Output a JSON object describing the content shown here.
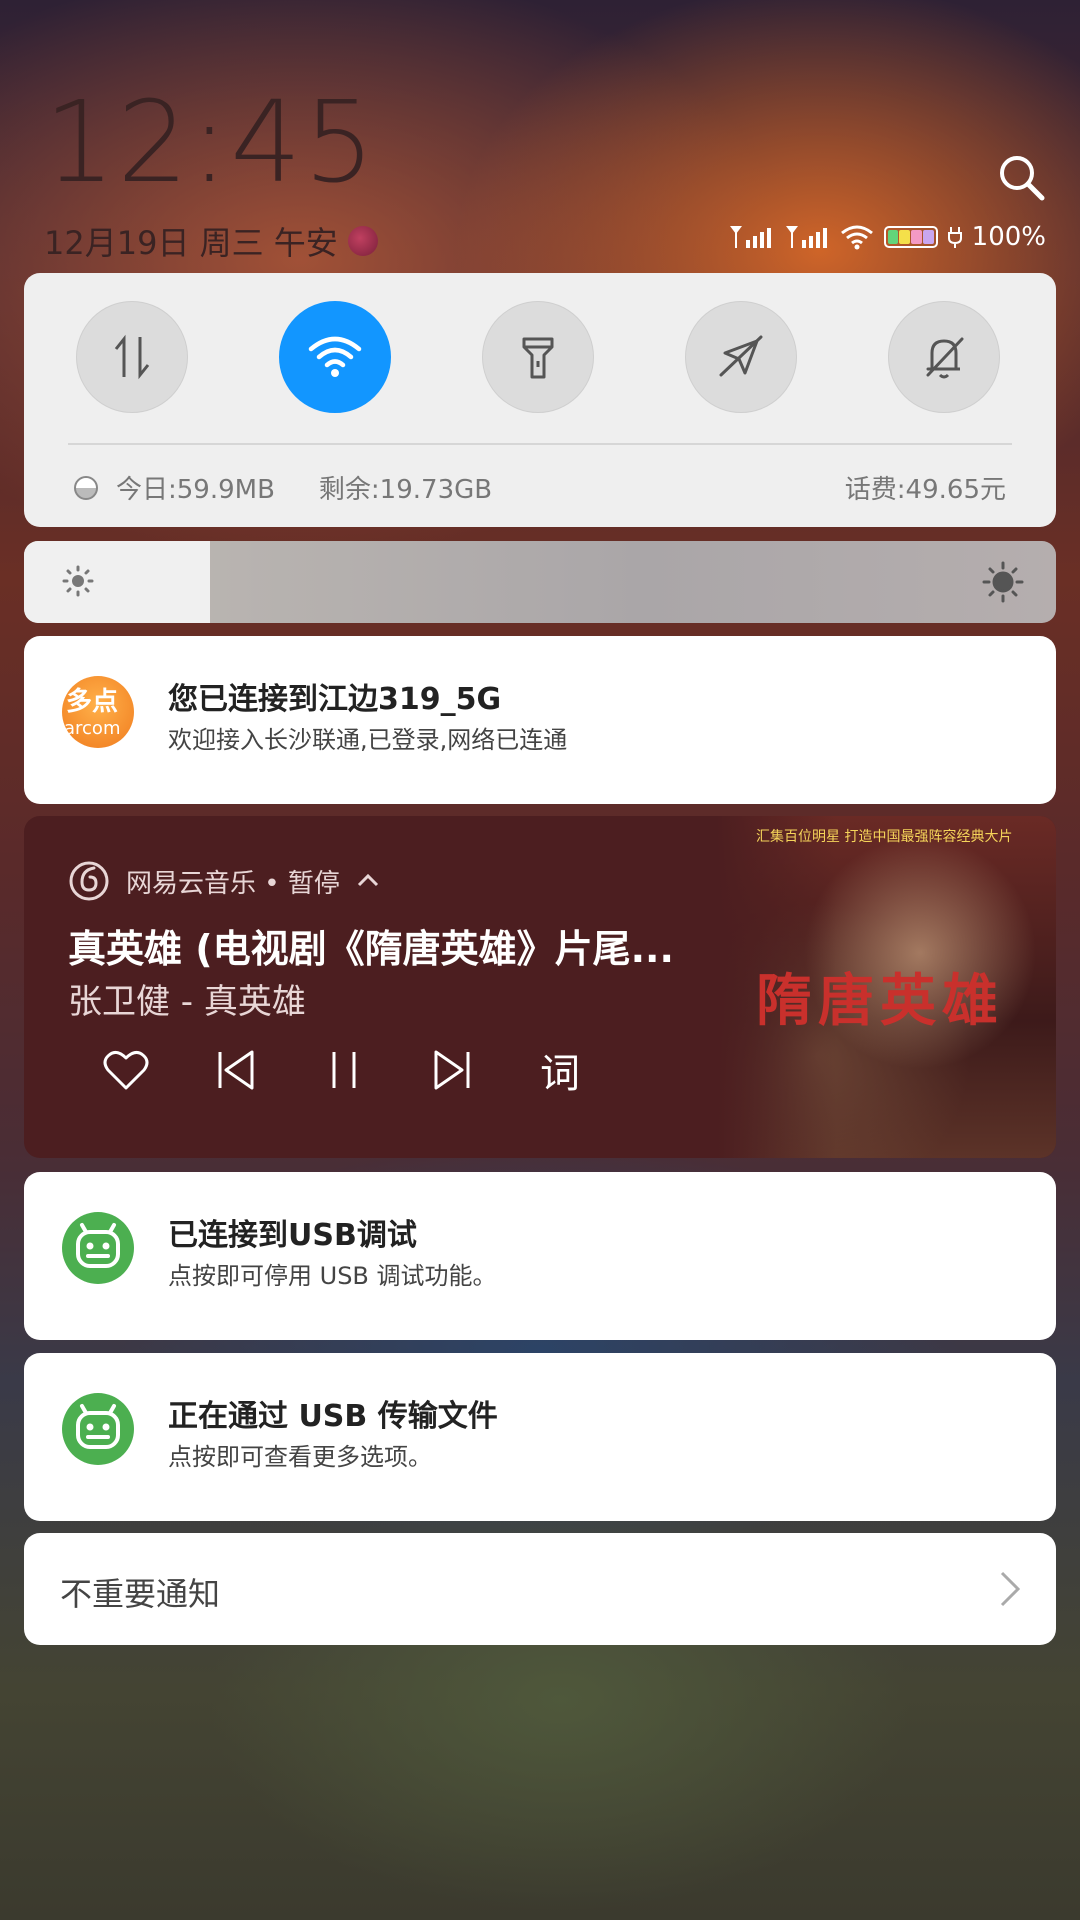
{
  "lockscreen": {
    "time": "12:45",
    "date": "12月19日 周三 午安"
  },
  "status_bar": {
    "battery": "100%"
  },
  "quick_settings": {
    "toggles": [
      {
        "name": "mobile-data",
        "on": false
      },
      {
        "name": "wifi",
        "on": true
      },
      {
        "name": "flashlight",
        "on": false
      },
      {
        "name": "airplane-mode",
        "on": false
      },
      {
        "name": "do-not-disturb",
        "on": false
      }
    ],
    "data_today": "今日:59.9MB",
    "data_remaining": "剩余:19.73GB",
    "balance": "话费:49.65元",
    "active_color": "#1296ff"
  },
  "brightness": {
    "level": 0.18
  },
  "notifications": [
    {
      "title": "您已连接到江边319_5G",
      "text": "欢迎接入长沙联通,已登录,网络已连通"
    },
    {
      "title": "已连接到USB调试",
      "text": "点按即可停用 USB 调试功能。"
    },
    {
      "title": "正在通过 USB 传输文件",
      "text": "点按即可查看更多选项。"
    }
  ],
  "music": {
    "app": "网易云音乐 • 暂停",
    "song": "真英雄 (电视剧《隋唐英雄》片尾...",
    "artist": "张卫健 - 真英雄",
    "lyrics_label": "词",
    "album_banner": "汇集百位明星   打造中国最强阵容经典大片",
    "album_title": "隋唐英雄",
    "background_color": "#4c1e20"
  },
  "unimportant": {
    "label": "不重要通知"
  }
}
